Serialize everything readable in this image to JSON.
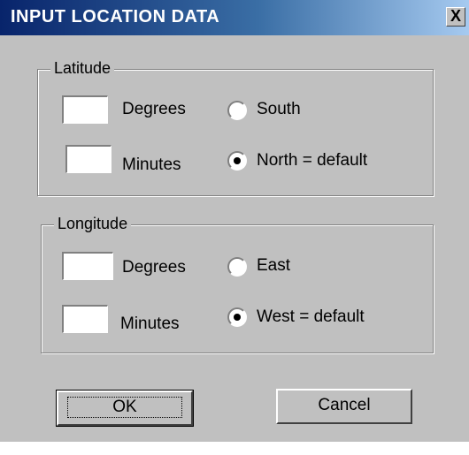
{
  "window": {
    "title": "INPUT LOCATION DATA",
    "close_label": "X"
  },
  "latitude": {
    "group_label": "Latitude",
    "degrees_value": "",
    "degrees_label": "Degrees",
    "minutes_value": "",
    "minutes_label": "Minutes",
    "option_south": "South",
    "option_north": "North = default",
    "selected": "north"
  },
  "longitude": {
    "group_label": "Longitude",
    "degrees_value": "",
    "degrees_label": "Degrees",
    "minutes_value": "",
    "minutes_label": "Minutes",
    "option_east": "East",
    "option_west": "West = default",
    "selected": "west"
  },
  "buttons": {
    "ok": "OK",
    "cancel": "Cancel"
  }
}
